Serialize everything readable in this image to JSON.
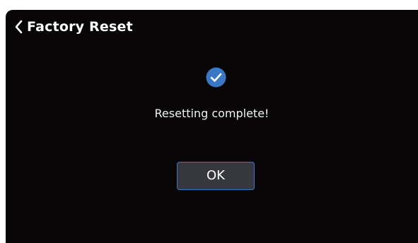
{
  "header": {
    "back_icon": "chevron-left-icon",
    "title": "Factory Reset"
  },
  "dialog": {
    "status_icon": "check-circle-icon",
    "message": "Resetting complete!",
    "ok_label": "OK"
  },
  "colors": {
    "background": "#080606",
    "accent": "#3a78c6",
    "button_fill": "#36383d",
    "text": "#ffffff"
  }
}
